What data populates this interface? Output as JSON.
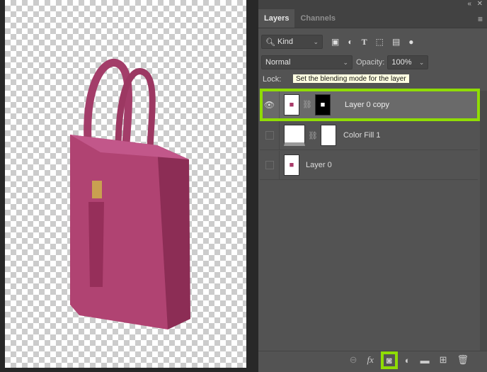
{
  "panel": {
    "tabs": [
      {
        "label": "Layers"
      },
      {
        "label": "Channels"
      }
    ],
    "filter": {
      "label": "Kind"
    },
    "blend_mode": "Normal",
    "opacity_label": "Opacity:",
    "opacity_value": "100%",
    "lock_label": "Lock:",
    "tooltip": "Set the blending mode for the layer",
    "layers": [
      {
        "name": "Layer 0 copy",
        "visible": true,
        "selected": true
      },
      {
        "name": "Color Fill 1",
        "visible": false
      },
      {
        "name": "Layer 0",
        "visible": false
      }
    ]
  },
  "colors": {
    "highlight": "#8fdc05",
    "bag": "#a83a68"
  }
}
